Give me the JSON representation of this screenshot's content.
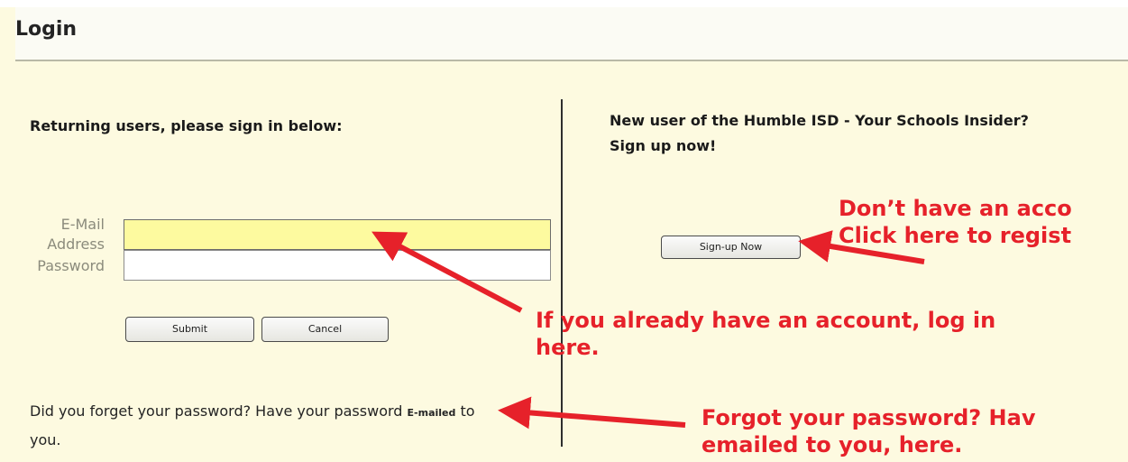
{
  "header": {
    "title": "Login"
  },
  "login": {
    "heading": "Returning users, please sign in below:",
    "email_label": "E-Mail Address",
    "email_value": "",
    "password_label": "Password",
    "password_value": "",
    "submit_label": "Submit",
    "cancel_label": "Cancel",
    "forgot_text": "Did you forget your password? Have your password",
    "forgot_link": "E-mailed",
    "forgot_suffix": " to you."
  },
  "signup": {
    "heading": "New user of the Humble ISD - Your Schools Insider? Sign up now!",
    "button_label": "Sign-up Now"
  },
  "annotations": {
    "register_line1": "Don’t have an acco",
    "register_line2": "Click here to regist",
    "login_line1": "If you already have an account, log in",
    "login_line2": "here.",
    "forgot_line1": "Forgot your password? Hav",
    "forgot_line2": "emailed to you, here."
  },
  "colors": {
    "annotation": "#e6212a",
    "background": "#fdfae0",
    "email_field": "#fdfa9f"
  }
}
